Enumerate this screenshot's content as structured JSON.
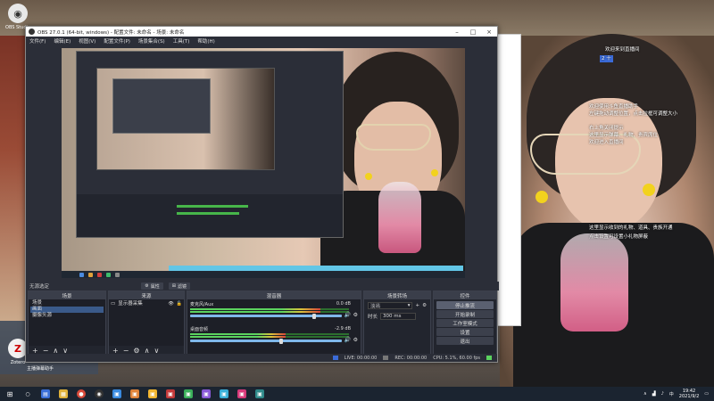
{
  "desktop": {
    "icons": [
      {
        "label": "OBS Studio"
      },
      {
        "label": "Zotero"
      }
    ],
    "overlay_right": [
      "欢迎来到直播间",
      "2 十",
      "欢迎使用斗鱼直播助手",
      "左键拖动调整位置，点击拉框可调整大小",
      "右上角关闭提示",
      "这里显示弹幕、礼物、贵宾席位",
      "欢迎进入直播间",
      "这里显示收到的礼物、道具、贵族开通",
      "点击设置可设置小礼物屏蔽"
    ],
    "watermark_left": "主播弹幕助手"
  },
  "obs": {
    "title": "OBS 27.0.1 (64-bit, windows) - 配置文件: 未命名 - 场景: 未命名",
    "menu": [
      "文件(F)",
      "编辑(E)",
      "视图(V)",
      "配置文件(P)",
      "场景集合(S)",
      "工具(T)",
      "帮助(H)"
    ],
    "status_strip": {
      "label": "无源选定",
      "properties_btn": "属性",
      "filters_btn": "滤镜"
    },
    "scenes": {
      "header": "场景",
      "items": [
        "场景",
        "画面",
        "摄像头源"
      ]
    },
    "sources": {
      "header": "来源",
      "items": [
        "显示器采集"
      ]
    },
    "mixer": {
      "header": "混音器",
      "tracks": [
        {
          "name": "麦克风/Aux",
          "db": "0.0 dB",
          "level": 0.82
        },
        {
          "name": "桌面音频",
          "db": "-2.9 dB",
          "level": 0.6
        }
      ]
    },
    "transitions": {
      "header": "场景转场",
      "type": "淡出",
      "duration_label": "时长",
      "duration": "300 ms"
    },
    "controls": {
      "header": "控件",
      "buttons": [
        "停止推流",
        "开始录制",
        "工作室模式",
        "设置",
        "退出"
      ]
    },
    "statusbar": {
      "live": "LIVE: 00:00:00",
      "rec": "REC: 00:00:00",
      "cpu": "CPU: 5.1%, 60.00 fps"
    }
  },
  "taskbar": {
    "time": "19:42",
    "date": "2021/9/2"
  },
  "colors": {
    "obs_bg": "#2b2e38",
    "meter_green": "#5bd35f",
    "fader_blue": "#7fb8ea"
  }
}
